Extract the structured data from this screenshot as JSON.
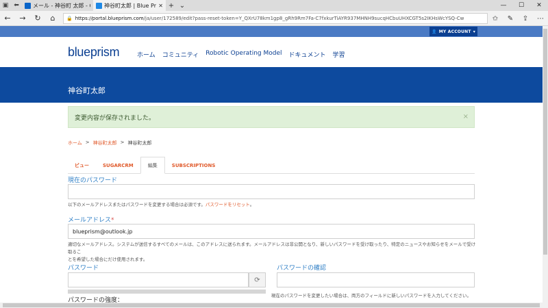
{
  "browser": {
    "tabs": [
      {
        "title": "メール - 神谷町 太郎 - Outloo",
        "favicon_color": "#0a64c8"
      },
      {
        "title": "神谷町太郎 | Blue Prism",
        "favicon_color": "#1e88e5"
      }
    ],
    "url_host": "https://portal.blueprism.com",
    "url_path": "/ja/user/172589/edit?pass-reset-token=Y_QXrU78km1gp8_gRh9Rm7Fa-C7fxkurTiAYR937MHNH9sucqHCbuUHXCGT5s2IKHsWcYSQ-Cw"
  },
  "site": {
    "account_button": "MY ACCOUNT",
    "logo": "blueprism",
    "nav": [
      "ホーム",
      "コミュニティ",
      "Robotic Operating Model",
      "ドキュメント",
      "学習"
    ],
    "page_title": "神谷町太郎",
    "alert": "変更内容が保存されました。",
    "breadcrumb": [
      "ホーム",
      "神谷町太郎",
      "神谷町太郎"
    ],
    "tabs": [
      "ビュー",
      "SUGARCRM",
      "編集",
      "SUBSCRIPTIONS"
    ],
    "active_tab": "編集"
  },
  "form": {
    "current_password": {
      "label": "現在のパスワード",
      "value": ""
    },
    "current_password_help": "以下のメールアドレスまたはパスワードを変更する場合は必須です。",
    "reset_link": "パスワードをリセット",
    "email": {
      "label": "メールアドレス",
      "required_mark": "*",
      "value": "blueprism@outlook.jp"
    },
    "email_help_1": "適切なメールアドレス。システムが送信するすべてのメールは、このアドレスに送られます。メールアドレスは非公開となり、新しいパスワードを受け取ったり、特定のニュースやお知らせをメールで受け取るこ",
    "email_help_2": "とを希望した場合にだけ使用されます。",
    "password": {
      "label": "パスワード",
      "value": ""
    },
    "password_confirm": {
      "label": "パスワードの確認",
      "value": ""
    },
    "confirm_help": "現在のパスワードを変更したい場合は、両方のフィールドに新しいパスワードを入力してください。",
    "strength_label": "パスワードの強度："
  }
}
